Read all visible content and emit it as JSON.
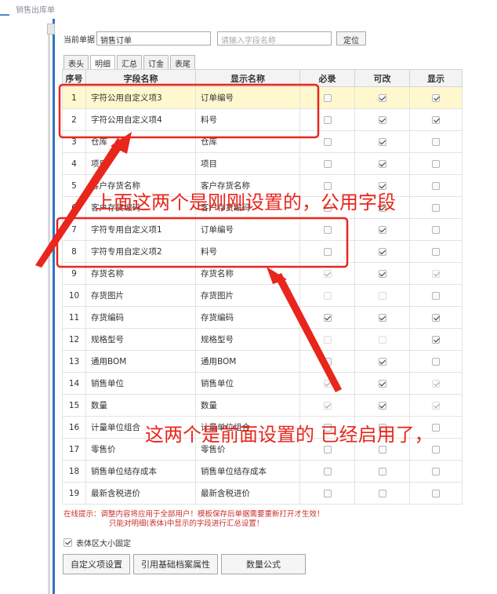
{
  "window": {
    "title": "销售出库单"
  },
  "toolbar": {
    "current_doc_label": "当前单据",
    "current_doc_value": "销售订单",
    "field_search_placeholder": "请输入字段名称",
    "locate_label": "定位"
  },
  "tabs": [
    "表头",
    "明细",
    "汇总",
    "订金",
    "表尾"
  ],
  "active_tab": "明细",
  "table": {
    "columns": [
      "序号",
      "字段名称",
      "显示名称",
      "必录",
      "可改",
      "显示"
    ],
    "rows": [
      {
        "no": "1",
        "field": "字符公用自定义项3",
        "display": "订单编号",
        "required": false,
        "editable": true,
        "visible": true,
        "highlight": true
      },
      {
        "no": "2",
        "field": "字符公用自定义项4",
        "display": "料号",
        "required": false,
        "editable": true,
        "visible": true
      },
      {
        "no": "3",
        "field": "仓库",
        "display": "仓库",
        "required": false,
        "editable": true,
        "visible": false
      },
      {
        "no": "4",
        "field": "项目",
        "display": "项目",
        "required": false,
        "editable": true,
        "visible": false
      },
      {
        "no": "5",
        "field": "客户存货名称",
        "display": "客户存货名称",
        "required": false,
        "editable": true,
        "visible": false
      },
      {
        "no": "6",
        "field": "客户存货编码",
        "display": "客户存货编码",
        "required": false,
        "editable": true,
        "visible": false
      },
      {
        "no": "7",
        "field": "字符专用自定义项1",
        "display": "订单编号",
        "required": false,
        "editable": true,
        "visible": false
      },
      {
        "no": "8",
        "field": "字符专用自定义项2",
        "display": "料号",
        "required": false,
        "editable": true,
        "visible": false
      },
      {
        "no": "9",
        "field": "存货名称",
        "display": "存货名称",
        "required": true,
        "editable": true,
        "visible": true,
        "dim_required": true,
        "dim_visible": true
      },
      {
        "no": "10",
        "field": "存货图片",
        "display": "存货图片",
        "required": false,
        "editable": false,
        "visible": false,
        "dim_required": true,
        "dim_editable": true
      },
      {
        "no": "11",
        "field": "存货编码",
        "display": "存货编码",
        "required": true,
        "editable": true,
        "visible": true
      },
      {
        "no": "12",
        "field": "规格型号",
        "display": "规格型号",
        "required": false,
        "editable": false,
        "visible": true,
        "dim_required": true,
        "dim_editable": true
      },
      {
        "no": "13",
        "field": "通用BOM",
        "display": "通用BOM",
        "required": false,
        "editable": true,
        "visible": false
      },
      {
        "no": "14",
        "field": "销售单位",
        "display": "销售单位",
        "required": true,
        "editable": true,
        "visible": true,
        "dim_required": true,
        "dim_visible": true
      },
      {
        "no": "15",
        "field": "数量",
        "display": "数量",
        "required": true,
        "editable": true,
        "visible": true,
        "dim_required": true,
        "dim_visible": true
      },
      {
        "no": "16",
        "field": "计量单位组合",
        "display": "计量单位组合",
        "required": false,
        "editable": false,
        "visible": false
      },
      {
        "no": "17",
        "field": "零售价",
        "display": "零售价",
        "required": false,
        "editable": false,
        "visible": false
      },
      {
        "no": "18",
        "field": "销售单位结存成本",
        "display": "销售单位结存成本",
        "required": false,
        "editable": false,
        "visible": false
      },
      {
        "no": "19",
        "field": "最新含税进价",
        "display": "最新含税进价",
        "required": false,
        "editable": false,
        "visible": false
      }
    ]
  },
  "tip": {
    "line1": "在线提示：调整内容将应用于全部用户！模板保存后单据需要重新打开才生效！",
    "line2": "只能对明细(表体)中显示的字段进行汇总设置！"
  },
  "fixed_size": {
    "label": "表体区大小固定",
    "checked": true
  },
  "buttons": {
    "custom_items": "自定义项设置",
    "ref_archive": "引用基础档案属性",
    "qty_formula": "数量公式"
  },
  "annotations": {
    "note1": "上面这两个是刚刚设置的，公用字段",
    "note2": "这两个是前面设置的 已经启用了，"
  },
  "colors": {
    "annotation": "#e8261c",
    "highlight_row": "#fff8cf",
    "tip_text": "#c9302c",
    "accent_bar": "#2d73c4"
  }
}
